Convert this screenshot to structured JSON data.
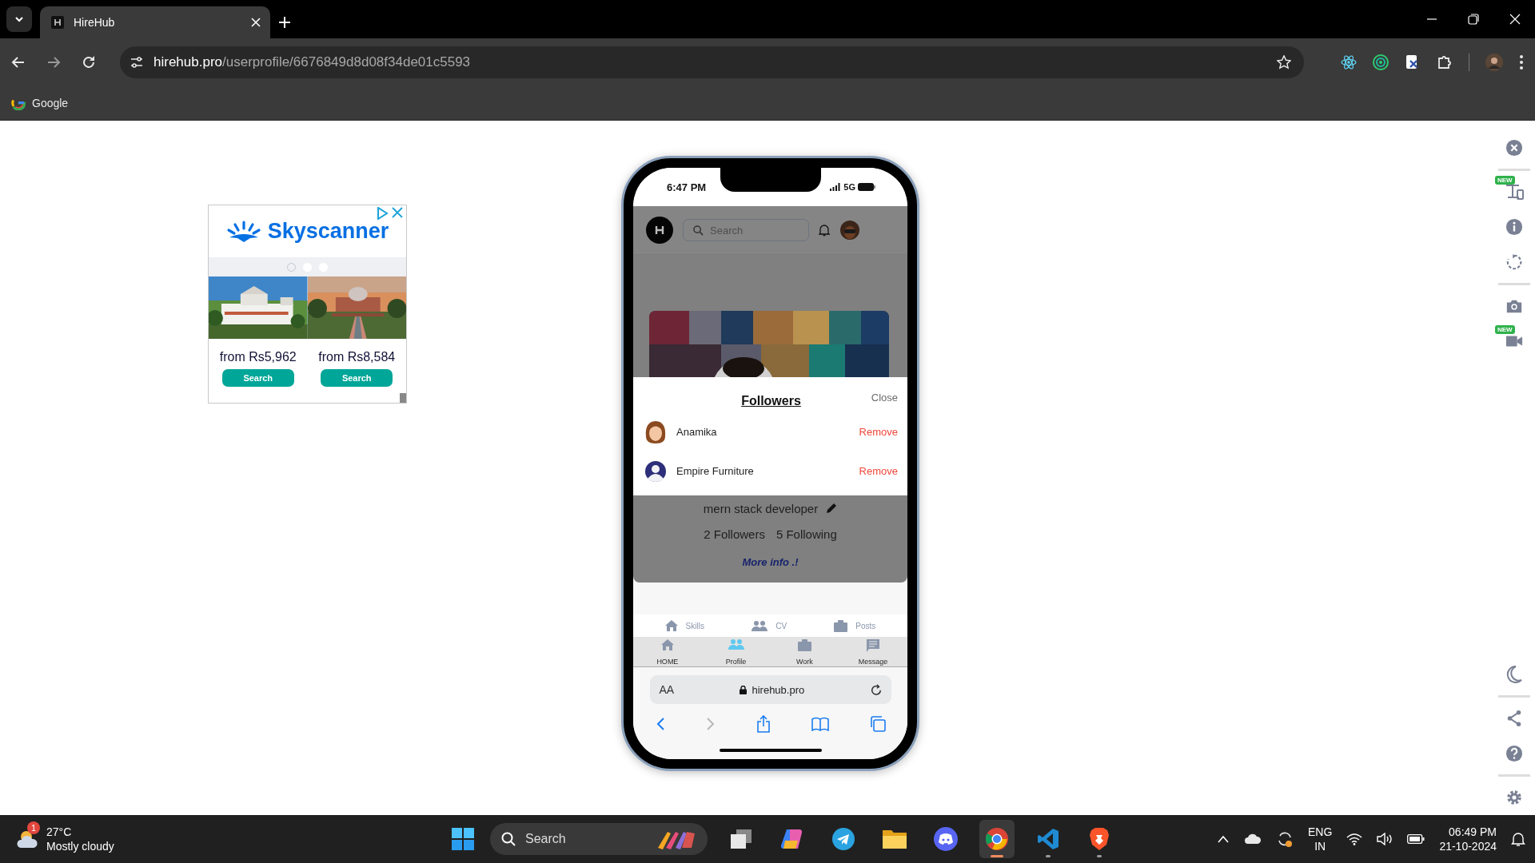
{
  "browser": {
    "tab_title": "HireHub",
    "url_host": "hirehub.pro",
    "url_path": "/userprofile/6676849d8d08f34de01c5593",
    "bookmarks": [
      {
        "label": "Google"
      }
    ]
  },
  "ad": {
    "brand": "Skyscanner",
    "dots": [
      {
        "selected": true
      },
      {
        "selected": false
      },
      {
        "selected": false
      }
    ],
    "offers": [
      {
        "price": "from Rs5,962",
        "button": "Search"
      },
      {
        "price": "from Rs8,584",
        "button": "Search"
      }
    ]
  },
  "phone": {
    "status": {
      "time": "6:47 PM",
      "network": "5G"
    },
    "app_header": {
      "search_placeholder": "Search"
    },
    "followers_dialog": {
      "title": "Followers",
      "close": "Close",
      "people": [
        {
          "name": "Anamika",
          "action": "Remove"
        },
        {
          "name": "Empire Furniture",
          "action": "Remove"
        }
      ]
    },
    "profile": {
      "headline": "mern stack developer",
      "followers": "2 Followers",
      "following": "5 Following",
      "more_info": "More info .!"
    },
    "profile_tabs": [
      {
        "label": "Skills"
      },
      {
        "label": "CV"
      },
      {
        "label": "Posts"
      }
    ],
    "bottom_nav": [
      {
        "label": "HOME",
        "selected": false
      },
      {
        "label": "Profile",
        "selected": true
      },
      {
        "label": "Work",
        "selected": false
      },
      {
        "label": "Message",
        "selected": false
      }
    ],
    "safari": {
      "text_size": "AA",
      "address": "hirehub.pro"
    }
  },
  "side_panel": {
    "badges": [
      "NEW",
      "NEW"
    ]
  },
  "taskbar": {
    "weather": {
      "alert": "1",
      "temp": "27°C",
      "condition": "Mostly cloudy"
    },
    "search_placeholder": "Search",
    "apps": [
      {
        "running": false,
        "selected": false
      },
      {
        "running": false,
        "selected": false
      },
      {
        "running": false,
        "selected": false
      },
      {
        "running": false,
        "selected": false
      },
      {
        "running": false,
        "selected": false
      },
      {
        "running": true,
        "selected": true
      },
      {
        "running": true,
        "selected": false
      },
      {
        "running": true,
        "selected": false
      }
    ],
    "tray": {
      "language": "ENG",
      "region": "IN",
      "time": "06:49 PM",
      "date": "21-10-2024"
    }
  }
}
